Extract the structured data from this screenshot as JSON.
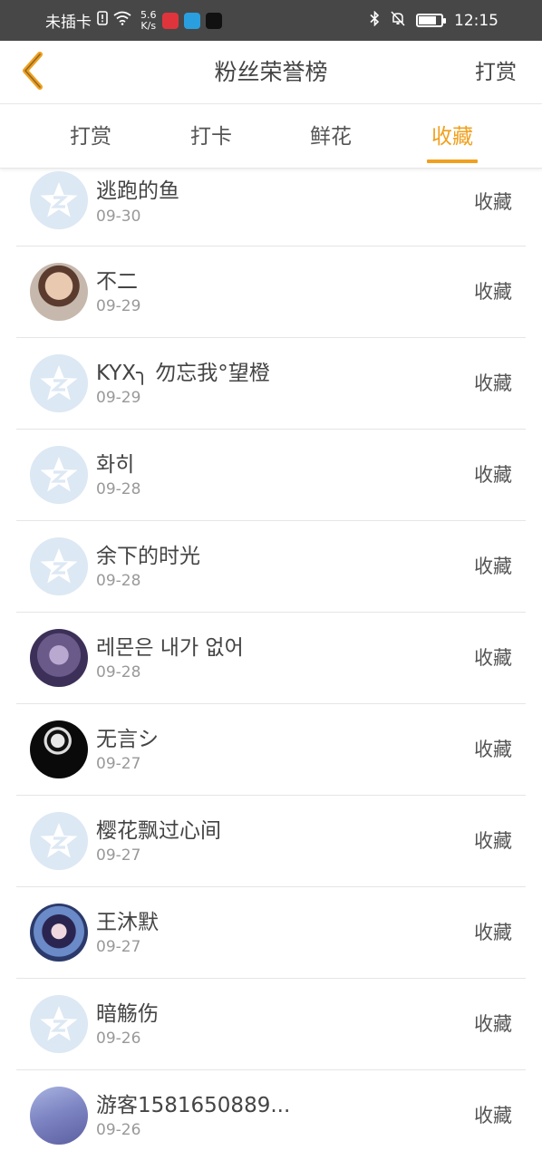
{
  "status_bar": {
    "carrier": "未插卡",
    "speed": "5.6",
    "speed_unit": "K/s",
    "time": "12:15"
  },
  "header": {
    "title": "粉丝荣誉榜",
    "action": "打赏"
  },
  "tabs": [
    {
      "label": "打赏",
      "active": false
    },
    {
      "label": "打卡",
      "active": false
    },
    {
      "label": "鲜花",
      "active": false
    },
    {
      "label": "收藏",
      "active": true
    }
  ],
  "colors": {
    "accent": "#F0A01E",
    "status_bar": "#474747"
  },
  "list": [
    {
      "name": "逃跑的鱼",
      "date": "09-30",
      "action": "收藏",
      "avatar": "default-avatar"
    },
    {
      "name": "不二",
      "date": "09-29",
      "action": "收藏",
      "avatar": "photo-avatar"
    },
    {
      "name": "KYX╮ 勿忘我°望橙",
      "date": "09-29",
      "action": "收藏",
      "avatar": "default-avatar"
    },
    {
      "name": "화히",
      "date": "09-28",
      "action": "收藏",
      "avatar": "default-avatar"
    },
    {
      "name": "余下的时光",
      "date": "09-28",
      "action": "收藏",
      "avatar": "default-avatar"
    },
    {
      "name": "레몬은 내가 없어",
      "date": "09-28",
      "action": "收藏",
      "avatar": "photo-avatar"
    },
    {
      "name": "无言シ",
      "date": "09-27",
      "action": "收藏",
      "avatar": "photo-avatar"
    },
    {
      "name": "樱花飘过心间",
      "date": "09-27",
      "action": "收藏",
      "avatar": "default-avatar"
    },
    {
      "name": "王沐默",
      "date": "09-27",
      "action": "收藏",
      "avatar": "photo-avatar"
    },
    {
      "name": "暗觞伤",
      "date": "09-26",
      "action": "收藏",
      "avatar": "default-avatar"
    },
    {
      "name": "游客1581650889...",
      "date": "09-26",
      "action": "收藏",
      "avatar": "photo-avatar"
    }
  ]
}
